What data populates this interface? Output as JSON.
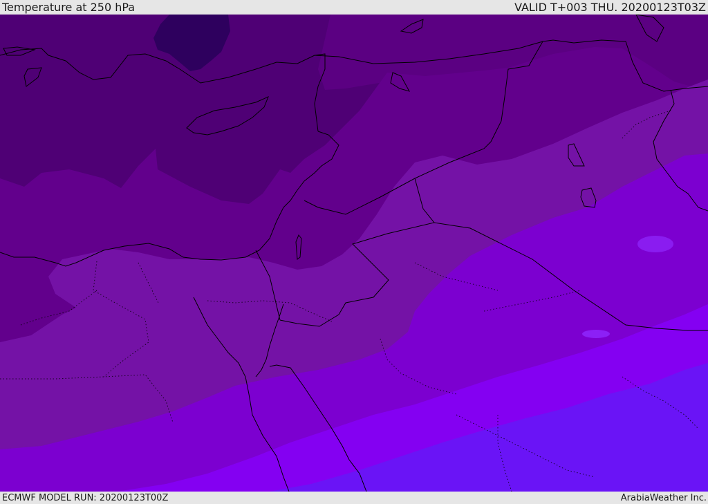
{
  "header": {
    "title": "Temperature at 250 hPa",
    "valid": "VALID T+003 THU. 20200123T03Z"
  },
  "footer": {
    "model_run": "ECMWF MODEL RUN: 20200123T00Z",
    "credit": "ArabiaWeather Inc."
  },
  "map": {
    "field": "temperature",
    "level": "250 hPa",
    "color_bands": [
      "#2e005e",
      "#4f0075",
      "#62008c",
      "#7412a6",
      "#7c00d0",
      "#8400f2",
      "#6a14f6"
    ],
    "icons": [
      "coastline",
      "country-border",
      "province-border"
    ]
  }
}
